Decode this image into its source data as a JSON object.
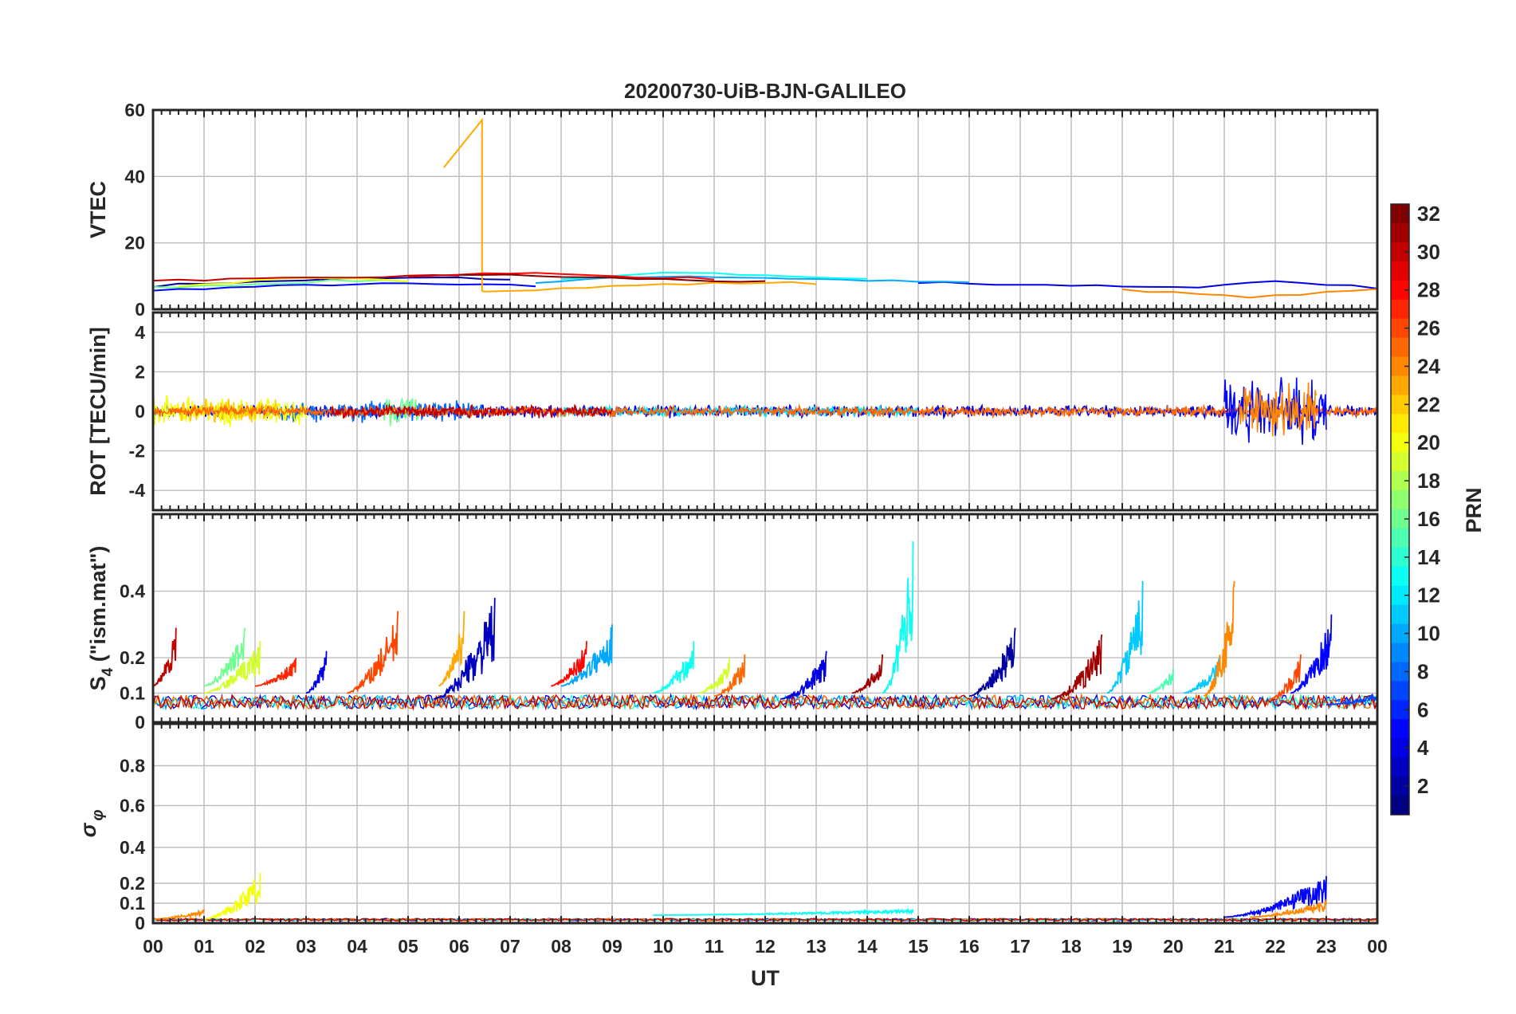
{
  "chart_data": {
    "type": "line",
    "title": "20200730-UiB-BJN-GALILEO",
    "xlabel": "UT",
    "x_ticks": [
      "00",
      "01",
      "02",
      "03",
      "04",
      "05",
      "06",
      "07",
      "08",
      "09",
      "10",
      "11",
      "12",
      "13",
      "14",
      "15",
      "16",
      "17",
      "18",
      "19",
      "20",
      "21",
      "22",
      "23",
      "00"
    ],
    "xlim": [
      0,
      24
    ],
    "grid": true,
    "colorbar": {
      "label": "PRN",
      "range": [
        1,
        32
      ],
      "ticks": [
        "2",
        "4",
        "6",
        "8",
        "10",
        "12",
        "14",
        "16",
        "18",
        "20",
        "22",
        "24",
        "26",
        "28",
        "30",
        "32"
      ],
      "colormap": "jet"
    },
    "panels": [
      {
        "id": "vtec",
        "ylabel": "VTEC",
        "ylim": [
          0,
          60
        ],
        "y_ticks": [
          "0",
          "20",
          "40",
          "60"
        ],
        "series": [
          {
            "prn": 2,
            "x": [
              0,
              0.5,
              1,
              1.5,
              2,
              2.5,
              3,
              3.5,
              4,
              4.5,
              5,
              5.5,
              6,
              6.5,
              7
            ],
            "y": [
              7,
              7.5,
              7.8,
              8,
              8.2,
              8.5,
              8.8,
              9,
              9.2,
              9.3,
              9.4,
              9.5,
              9.4,
              9.2,
              9
            ]
          },
          {
            "prn": 5,
            "x": [
              0,
              0.5,
              1,
              1.5,
              2,
              2.5,
              3,
              3.5,
              4,
              4.5,
              5,
              5.5,
              6,
              6.5,
              7,
              7.5
            ],
            "y": [
              5.5,
              6,
              6.3,
              6.5,
              6.8,
              7,
              7.2,
              7.4,
              7.5,
              7.6,
              7.7,
              7.5,
              7.4,
              7.3,
              7.2,
              7
            ]
          },
          {
            "prn": 4,
            "x": [
              15,
              15.5,
              16,
              16.5,
              17,
              17.5,
              18,
              18.5,
              19,
              19.5,
              20,
              20.5,
              21,
              21.5,
              22,
              22.5,
              23,
              23.5,
              24
            ],
            "y": [
              8,
              8,
              7.8,
              7.6,
              7.5,
              7.4,
              7.2,
              7,
              6.8,
              6.6,
              6.5,
              6.8,
              7.5,
              8,
              8.5,
              8,
              7.5,
              7,
              6.5
            ]
          },
          {
            "prn": 10,
            "x": [
              7.5,
              8,
              8.5,
              9,
              9.5,
              10,
              10.5,
              11,
              11.5,
              12,
              12.5,
              13,
              13.5,
              14,
              14.5,
              15,
              15.5,
              16
            ],
            "y": [
              8,
              8.5,
              9,
              9.3,
              9.6,
              10,
              10,
              9.8,
              9.6,
              9.5,
              9.3,
              9.1,
              8.9,
              8.7,
              8.5,
              8.3,
              8.1,
              8
            ]
          },
          {
            "prn": 13,
            "x": [
              8,
              8.5,
              9,
              9.5,
              10,
              10.5,
              11,
              11.5,
              12,
              12.5,
              13,
              13.5,
              14
            ],
            "y": [
              9,
              9.5,
              10,
              10.4,
              10.8,
              11,
              10.8,
              10.5,
              10.2,
              10,
              9.7,
              9.4,
              9
            ]
          },
          {
            "prn": 16,
            "x": [
              0,
              0.5,
              1,
              1.5,
              2,
              2.5,
              3,
              3.5,
              4,
              4.5,
              5
            ],
            "y": [
              6.5,
              6.8,
              7,
              7.3,
              7.6,
              7.9,
              8.2,
              8.5,
              8.6,
              8.7,
              8.5
            ]
          },
          {
            "prn": 20,
            "x": [
              0.5,
              1,
              1.5,
              2,
              2.5,
              3,
              3.5,
              4,
              4.5,
              5
            ],
            "y": [
              7,
              7.5,
              8,
              8.5,
              9,
              9.2,
              9.1,
              9,
              8.8,
              8.5
            ]
          },
          {
            "prn": 23,
            "x": [
              5.7,
              6.45,
              6.45,
              6.5,
              7,
              7.5,
              8,
              8.5,
              9,
              9.5,
              10,
              10.5,
              11,
              11.5,
              12,
              12.5,
              13
            ],
            "y": [
              43,
              57,
              5.5,
              5.5,
              5.8,
              6,
              6.3,
              6.6,
              6.9,
              7.2,
              7.5,
              7.6,
              7.8,
              7.9,
              8,
              8,
              7.8
            ]
          },
          {
            "prn": 24,
            "x": [
              19,
              19.5,
              20,
              20.5,
              21,
              21.5,
              22,
              22.5,
              23,
              23.5,
              24
            ],
            "y": [
              6,
              5.5,
              5,
              4.5,
              4,
              3.8,
              4,
              4.5,
              5,
              5.5,
              6
            ]
          },
          {
            "prn": 28,
            "x": [
              5,
              5.5,
              6,
              6.5,
              7,
              7.5,
              8,
              8.5,
              9,
              9.5,
              10,
              10.5,
              11
            ],
            "y": [
              10,
              10.3,
              10.6,
              10.8,
              11,
              10.8,
              10.5,
              10.2,
              10,
              9.8,
              9.6,
              9.4,
              9.2
            ]
          },
          {
            "prn": 30,
            "x": [
              0,
              0.5,
              1,
              1.5,
              2,
              2.5,
              3,
              3.5,
              4,
              4.5,
              5,
              5.5,
              6
            ],
            "y": [
              8.5,
              8.7,
              8.9,
              9,
              9.1,
              9.2,
              9.3,
              9.4,
              9.6,
              9.8,
              10,
              10.1,
              10.2
            ]
          },
          {
            "prn": 32,
            "x": [
              6,
              6.5,
              7,
              7.5,
              8,
              8.5,
              9,
              9.5,
              10,
              10.5,
              11,
              11.5,
              12
            ],
            "y": [
              10.5,
              10.4,
              10.2,
              10,
              9.8,
              9.6,
              9.4,
              9.2,
              9,
              8.8,
              8.6,
              8.4,
              8.2
            ]
          }
        ]
      },
      {
        "id": "rot",
        "ylabel": "ROT [TECU/min]",
        "ylim": [
          -5,
          5
        ],
        "y_ticks": [
          "-4",
          "-2",
          "0",
          "2",
          "4"
        ],
        "activity": [
          {
            "prn": 4,
            "x_range": [
              0,
              24
            ],
            "amp": 0.3
          },
          {
            "prn": 8,
            "x_range": [
              2.5,
              6.5
            ],
            "amp": 0.5
          },
          {
            "prn": 12,
            "x_range": [
              8,
              15
            ],
            "amp": 0.25
          },
          {
            "prn": 16,
            "x_range": [
              4.5,
              5.2
            ],
            "amp": 0.8
          },
          {
            "prn": 20,
            "x_range": [
              0,
              3
            ],
            "amp": 0.7
          },
          {
            "prn": 22,
            "x_range": [
              0.5,
              2.5
            ],
            "amp": 0.6
          },
          {
            "prn": 25,
            "x_range": [
              0,
              24
            ],
            "amp": 0.25
          },
          {
            "prn": 30,
            "x_range": [
              3.5,
              9
            ],
            "amp": 0.3
          },
          {
            "prn": 5,
            "x_range": [
              21,
              23
            ],
            "amp": 1.5
          },
          {
            "prn": 24,
            "x_range": [
              21.3,
              22.8
            ],
            "amp": 1.3
          }
        ]
      },
      {
        "id": "s4",
        "ylabel": "S4 (\"ism.mat\")",
        "ylim": [
          0,
          0.6
        ],
        "y_ticks": [
          "0",
          "0.1",
          "0.2",
          "0.4"
        ],
        "bursts": [
          {
            "prn": 30,
            "x_range": [
              0,
              0.45
            ],
            "base": 0.12,
            "peak": 0.29
          },
          {
            "prn": 16,
            "x_range": [
              1,
              1.8
            ],
            "base": 0.12,
            "peak": 0.29
          },
          {
            "prn": 19,
            "x_range": [
              1,
              2.1
            ],
            "base": 0.1,
            "peak": 0.25
          },
          {
            "prn": 27,
            "x_range": [
              2,
              2.8
            ],
            "base": 0.12,
            "peak": 0.2
          },
          {
            "prn": 4,
            "x_range": [
              3,
              3.4
            ],
            "base": 0.1,
            "peak": 0.22
          },
          {
            "prn": 26,
            "x_range": [
              3.8,
              4.8
            ],
            "base": 0.1,
            "peak": 0.34
          },
          {
            "prn": 3,
            "x_range": [
              5.5,
              6.7
            ],
            "base": 0.08,
            "peak": 0.38
          },
          {
            "prn": 23,
            "x_range": [
              5.6,
              6.1
            ],
            "base": 0.12,
            "peak": 0.34
          },
          {
            "prn": 28,
            "x_range": [
              7.8,
              8.5
            ],
            "base": 0.12,
            "peak": 0.25
          },
          {
            "prn": 10,
            "x_range": [
              8,
              9
            ],
            "base": 0.12,
            "peak": 0.3
          },
          {
            "prn": 13,
            "x_range": [
              9.8,
              10.6
            ],
            "base": 0.1,
            "peak": 0.25
          },
          {
            "prn": 19,
            "x_range": [
              10.7,
              11.3
            ],
            "base": 0.1,
            "peak": 0.2
          },
          {
            "prn": 25,
            "x_range": [
              11,
              11.6
            ],
            "base": 0.09,
            "peak": 0.21
          },
          {
            "prn": 4,
            "x_range": [
              12.3,
              13.2
            ],
            "base": 0.08,
            "peak": 0.22
          },
          {
            "prn": 31,
            "x_range": [
              13.7,
              14.3
            ],
            "base": 0.1,
            "peak": 0.21
          },
          {
            "prn": 13,
            "x_range": [
              14.3,
              14.9
            ],
            "base": 0.1,
            "peak": 0.55
          },
          {
            "prn": 2,
            "x_range": [
              16,
              16.9
            ],
            "base": 0.09,
            "peak": 0.29
          },
          {
            "prn": 31,
            "x_range": [
              17.6,
              18.6
            ],
            "base": 0.08,
            "peak": 0.27
          },
          {
            "prn": 11,
            "x_range": [
              18.7,
              19.4
            ],
            "base": 0.1,
            "peak": 0.43
          },
          {
            "prn": 15,
            "x_range": [
              19.5,
              20
            ],
            "base": 0.1,
            "peak": 0.17
          },
          {
            "prn": 11,
            "x_range": [
              20.2,
              20.9
            ],
            "base": 0.1,
            "peak": 0.2
          },
          {
            "prn": 24,
            "x_range": [
              20.6,
              21.2
            ],
            "base": 0.09,
            "peak": 0.43
          },
          {
            "prn": 26,
            "x_range": [
              21.9,
              22.5
            ],
            "base": 0.08,
            "peak": 0.21
          },
          {
            "prn": 5,
            "x_range": [
              22.3,
              23.1
            ],
            "base": 0.1,
            "peak": 0.33
          },
          {
            "prn": 7,
            "x_range": [
              23,
              24
            ],
            "base": 0.06,
            "peak": 0.1
          }
        ]
      },
      {
        "id": "sigma_phi",
        "ylabel": "σφ",
        "ylim": [
          0,
          1
        ],
        "y_ticks": [
          "0",
          "0.1",
          "0.2",
          "0.4",
          "0.6",
          "0.8"
        ],
        "bursts": [
          {
            "prn": 20,
            "x_range": [
              1,
              2.1
            ],
            "base": 0.02,
            "peak": 0.26
          },
          {
            "prn": 24,
            "x_range": [
              0,
              1
            ],
            "base": 0.02,
            "peak": 0.07
          },
          {
            "prn": 13,
            "x_range": [
              9.8,
              14.9
            ],
            "base": 0.04,
            "peak": 0.07
          },
          {
            "prn": 5,
            "x_range": [
              21,
              23
            ],
            "base": 0.03,
            "peak": 0.24
          },
          {
            "prn": 24,
            "x_range": [
              21.5,
              23
            ],
            "base": 0.03,
            "peak": 0.12
          }
        ]
      }
    ]
  }
}
